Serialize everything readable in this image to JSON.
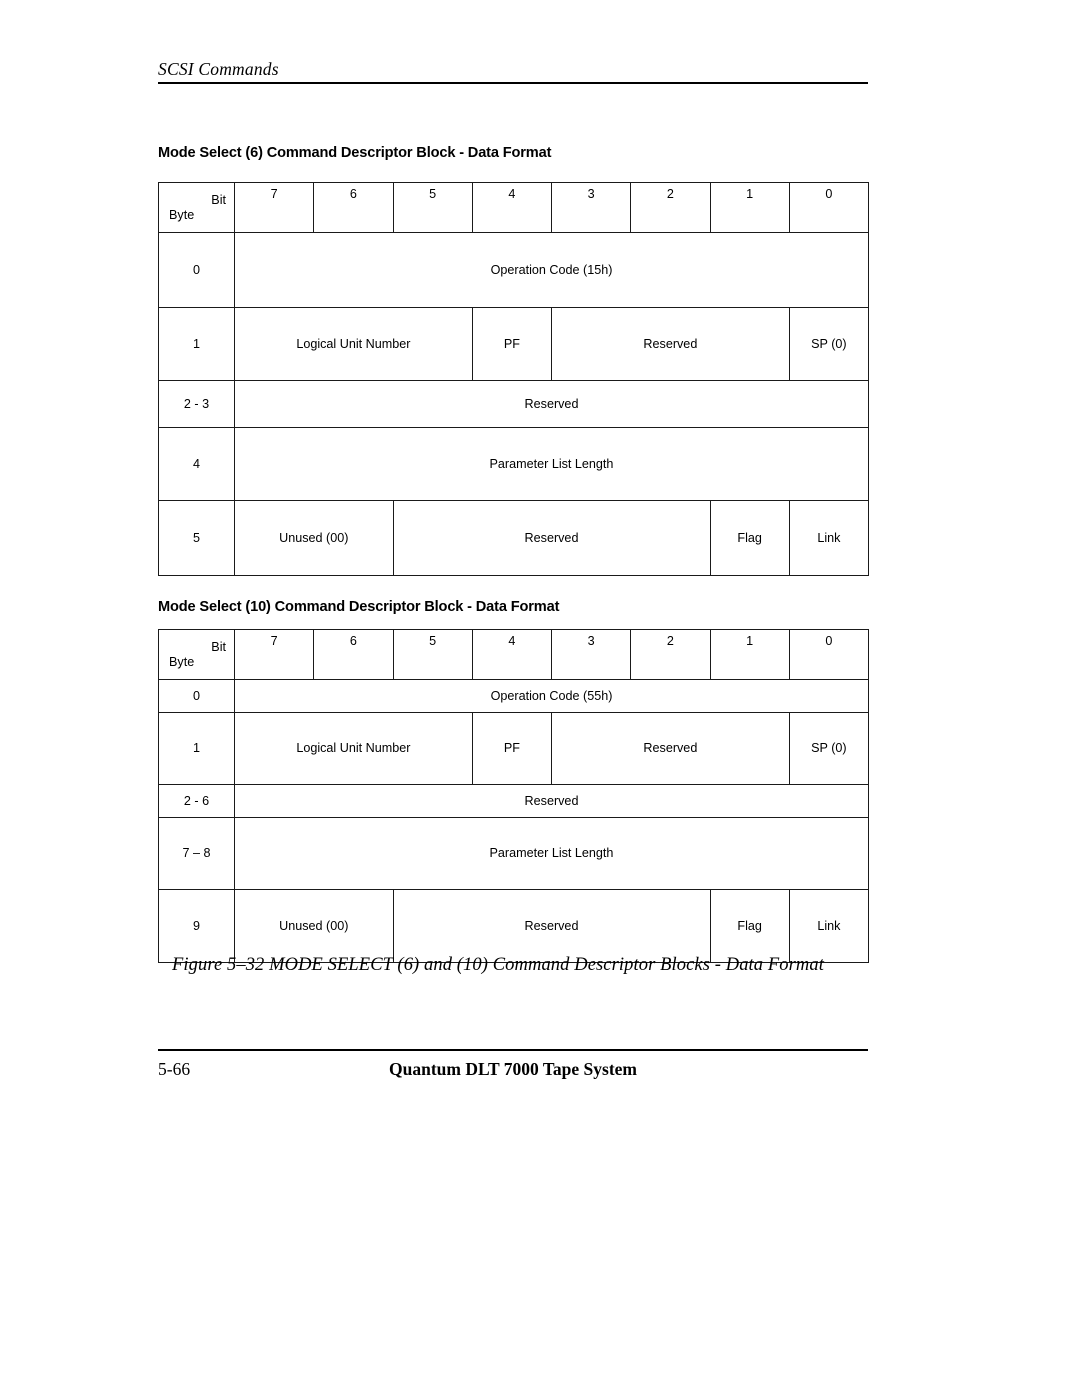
{
  "running_head": "SCSI Commands",
  "figure_caption": "Figure 5–32  MODE SELECT (6) and (10) Command Descriptor Blocks - Data Format",
  "footer": {
    "page_number": "5-66",
    "document_title": "Quantum DLT 7000 Tape System"
  },
  "header_labels": {
    "bit": "Bit",
    "byte": "Byte"
  },
  "bit_columns": [
    "7",
    "6",
    "5",
    "4",
    "3",
    "2",
    "1",
    "0"
  ],
  "tables": [
    {
      "title": "Mode Select (6) Command Descriptor Block - Data Format",
      "rows": [
        {
          "byte": "0",
          "cells": [
            {
              "text": "Operation Code (15h)",
              "span": 8
            }
          ]
        },
        {
          "byte": "1",
          "cells": [
            {
              "text": "Logical Unit Number",
              "span": 3
            },
            {
              "text": "PF",
              "span": 1
            },
            {
              "text": "Reserved",
              "span": 3
            },
            {
              "text": "SP (0)",
              "span": 1
            }
          ]
        },
        {
          "byte": "2 - 3",
          "cells": [
            {
              "text": "Reserved",
              "span": 8
            }
          ]
        },
        {
          "byte": "4",
          "cells": [
            {
              "text": "Parameter List Length",
              "span": 8
            }
          ]
        },
        {
          "byte": "5",
          "cells": [
            {
              "text": "Unused (00)",
              "span": 2
            },
            {
              "text": "Reserved",
              "span": 4
            },
            {
              "text": "Flag",
              "span": 1
            },
            {
              "text": "Link",
              "span": 1
            }
          ]
        }
      ]
    },
    {
      "title": "Mode Select (10) Command Descriptor Block - Data Format",
      "rows": [
        {
          "byte": "0",
          "cells": [
            {
              "text": "Operation Code (55h)",
              "span": 8
            }
          ]
        },
        {
          "byte": "1",
          "cells": [
            {
              "text": "Logical Unit Number",
              "span": 3
            },
            {
              "text": "PF",
              "span": 1
            },
            {
              "text": "Reserved",
              "span": 3
            },
            {
              "text": "SP (0)",
              "span": 1
            }
          ]
        },
        {
          "byte": "2 - 6",
          "cells": [
            {
              "text": "Reserved",
              "span": 8
            }
          ]
        },
        {
          "byte": "7 – 8",
          "cells": [
            {
              "text": "Parameter List Length",
              "span": 8
            }
          ]
        },
        {
          "byte": "9",
          "cells": [
            {
              "text": "Unused (00)",
              "span": 2
            },
            {
              "text": "Reserved",
              "span": 4
            },
            {
              "text": "Flag",
              "span": 1
            },
            {
              "text": "Link",
              "span": 1
            }
          ]
        }
      ]
    }
  ]
}
